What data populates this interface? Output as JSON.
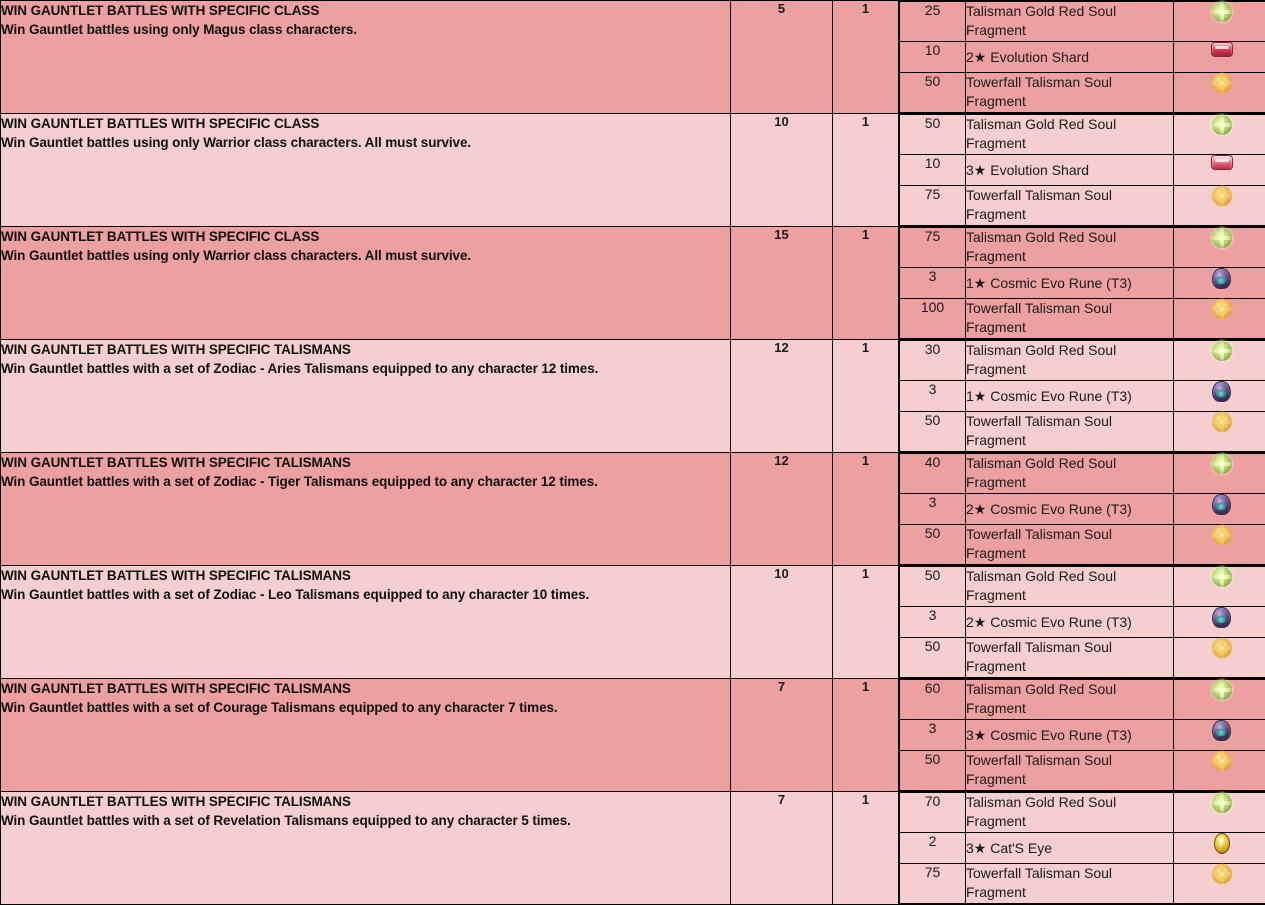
{
  "table": {
    "colors": {
      "row_dark": "#eda0a0",
      "row_light": "#f5cfcf",
      "border": "#000000",
      "text": "#1a1a1a"
    },
    "rows": [
      {
        "shade": "dark",
        "title": "WIN GAUNTLET BATTLES WITH SPECIFIC CLASS",
        "description": "Win Gauntlet battles using only Magus class characters.",
        "count": "5",
        "times": "1",
        "rewards": [
          {
            "qty": "25",
            "name": "Talisman Gold Red Soul Fragment",
            "icon": "soul-fragment-icon"
          },
          {
            "qty": "10",
            "name": "2★ Evolution Shard",
            "icon": "evolution-shard-icon"
          },
          {
            "qty": "50",
            "name": "Towerfall Talisman Soul Fragment",
            "icon": "towerfall-fragment-icon"
          }
        ]
      },
      {
        "shade": "light",
        "title": "WIN GAUNTLET BATTLES WITH SPECIFIC CLASS",
        "description": "Win Gauntlet battles using only Warrior class characters. All must survive.",
        "count": "10",
        "times": "1",
        "rewards": [
          {
            "qty": "50",
            "name": "Talisman Gold Red Soul Fragment",
            "icon": "soul-fragment-icon"
          },
          {
            "qty": "10",
            "name": "3★ Evolution Shard",
            "icon": "evolution-shard-icon"
          },
          {
            "qty": "75",
            "name": "Towerfall Talisman Soul Fragment",
            "icon": "towerfall-fragment-icon"
          }
        ]
      },
      {
        "shade": "dark",
        "title": "WIN GAUNTLET BATTLES WITH SPECIFIC CLASS",
        "description": "Win Gauntlet battles using only Warrior class characters. All must survive.",
        "count": "15",
        "times": "1",
        "rewards": [
          {
            "qty": "75",
            "name": "Talisman Gold Red Soul Fragment",
            "icon": "soul-fragment-icon"
          },
          {
            "qty": "3",
            "name": "1★ Cosmic Evo Rune (T3)",
            "icon": "cosmic-evo-rune-icon"
          },
          {
            "qty": "100",
            "name": "Towerfall Talisman Soul Fragment",
            "icon": "towerfall-fragment-icon"
          }
        ]
      },
      {
        "shade": "light",
        "title": "WIN GAUNTLET BATTLES WITH SPECIFIC TALISMANS",
        "description": "Win Gauntlet battles with a set of Zodiac - Aries Talismans equipped to any character 12 times.",
        "count": "12",
        "times": "1",
        "rewards": [
          {
            "qty": "30",
            "name": "Talisman Gold Red Soul Fragment",
            "icon": "soul-fragment-icon"
          },
          {
            "qty": "3",
            "name": "1★ Cosmic Evo Rune (T3)",
            "icon": "cosmic-evo-rune-icon"
          },
          {
            "qty": "50",
            "name": "Towerfall Talisman Soul Fragment",
            "icon": "towerfall-fragment-icon"
          }
        ]
      },
      {
        "shade": "dark",
        "title": "WIN GAUNTLET BATTLES WITH SPECIFIC TALISMANS",
        "description": "Win Gauntlet battles with a set of Zodiac - Tiger Talismans equipped to any character 12 times.",
        "count": "12",
        "times": "1",
        "rewards": [
          {
            "qty": "40",
            "name": "Talisman Gold Red Soul Fragment",
            "icon": "soul-fragment-icon"
          },
          {
            "qty": "3",
            "name": "2★ Cosmic Evo Rune (T3)",
            "icon": "cosmic-evo-rune-icon"
          },
          {
            "qty": "50",
            "name": "Towerfall Talisman Soul Fragment",
            "icon": "towerfall-fragment-icon"
          }
        ]
      },
      {
        "shade": "light",
        "title": "WIN GAUNTLET BATTLES WITH SPECIFIC TALISMANS",
        "description": "Win Gauntlet battles with a set of Zodiac - Leo Talismans equipped to any character 10 times.",
        "count": "10",
        "times": "1",
        "rewards": [
          {
            "qty": "50",
            "name": "Talisman Gold Red Soul Fragment",
            "icon": "soul-fragment-icon"
          },
          {
            "qty": "3",
            "name": "2★ Cosmic Evo Rune (T3)",
            "icon": "cosmic-evo-rune-icon"
          },
          {
            "qty": "50",
            "name": "Towerfall Talisman Soul Fragment",
            "icon": "towerfall-fragment-icon"
          }
        ]
      },
      {
        "shade": "dark",
        "title": "WIN GAUNTLET BATTLES WITH SPECIFIC TALISMANS",
        "description": "Win Gauntlet battles with a set of Courage Talismans equipped to any character 7 times.",
        "count": "7",
        "times": "1",
        "rewards": [
          {
            "qty": "60",
            "name": "Talisman Gold Red Soul Fragment",
            "icon": "soul-fragment-icon"
          },
          {
            "qty": "3",
            "name": "3★ Cosmic Evo Rune (T3)",
            "icon": "cosmic-evo-rune-icon"
          },
          {
            "qty": "50",
            "name": "Towerfall Talisman Soul Fragment",
            "icon": "towerfall-fragment-icon"
          }
        ]
      },
      {
        "shade": "light",
        "title": "WIN GAUNTLET BATTLES WITH SPECIFIC TALISMANS",
        "description": "Win Gauntlet battles with a set of Revelation Talismans equipped to any character 5 times.",
        "count": "7",
        "times": "1",
        "rewards": [
          {
            "qty": "70",
            "name": "Talisman Gold Red Soul Fragment",
            "icon": "soul-fragment-icon"
          },
          {
            "qty": "2",
            "name": "3★ Cat'S Eye",
            "icon": "cats-eye-icon"
          },
          {
            "qty": "75",
            "name": "Towerfall Talisman Soul Fragment",
            "icon": "towerfall-fragment-icon"
          }
        ]
      }
    ]
  }
}
